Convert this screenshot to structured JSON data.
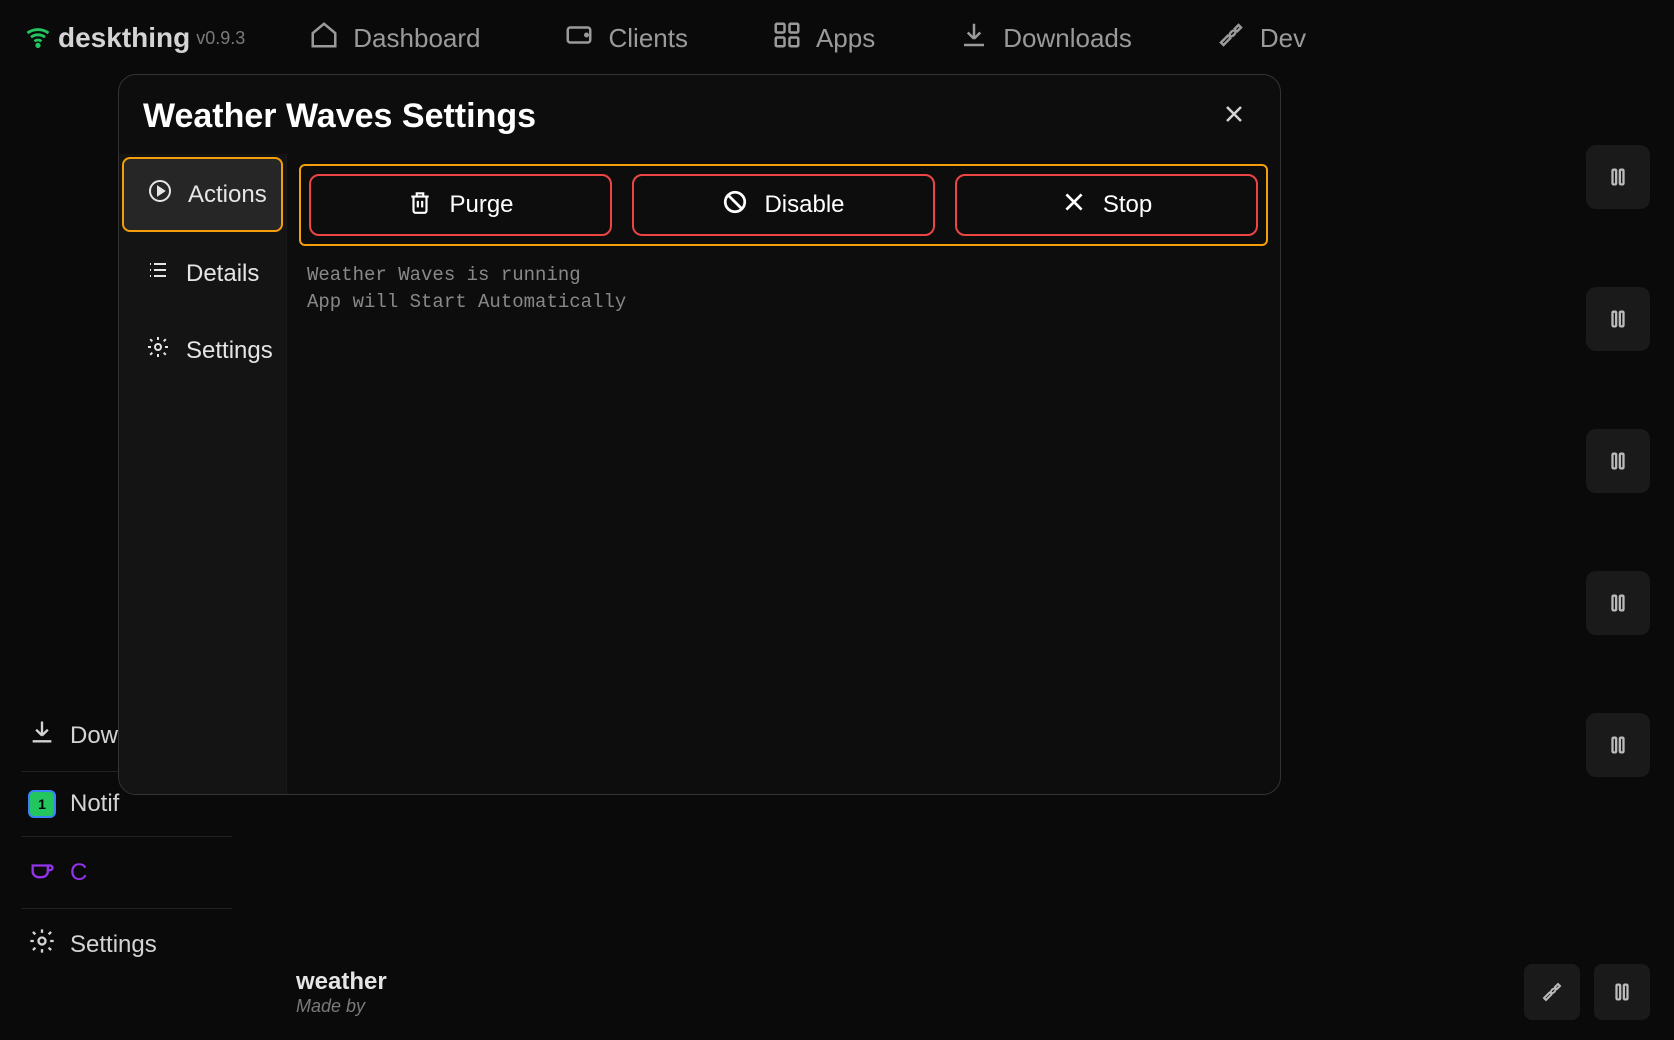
{
  "brand": {
    "name": "deskthing",
    "version": "v0.9.3"
  },
  "nav": {
    "dashboard": "Dashboard",
    "clients": "Clients",
    "apps": "Apps",
    "downloads": "Downloads",
    "dev": "Dev"
  },
  "bottomSidebar": {
    "downloads": "Dow",
    "notifications": "Notif",
    "notificationCount": "1",
    "coffee": "C",
    "settings": "Settings"
  },
  "bottomApp": {
    "name": "weather",
    "madeby": "Made by"
  },
  "modal": {
    "title": "Weather Waves Settings",
    "tabs": {
      "actions": "Actions",
      "details": "Details",
      "settings": "Settings"
    },
    "actions": {
      "purge": "Purge",
      "disable": "Disable",
      "stop": "Stop"
    },
    "status": "Weather Waves is running\nApp will Start Automatically"
  }
}
